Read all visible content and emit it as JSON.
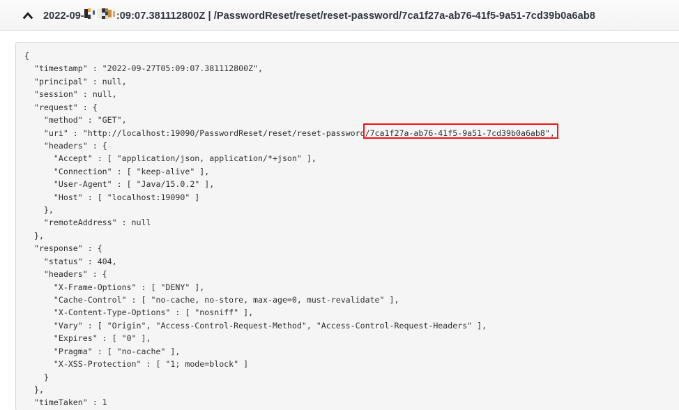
{
  "header": {
    "icon": "chevron-up-icon",
    "timestamp_prefix": "2022-09-",
    "timestamp_suffix": ":09:07.381112800Z",
    "separator": " | ",
    "path": "/PasswordReset/reset/reset-password/7ca1f27a-ab76-41f5-9a51-7cd39b0a6ab8",
    "full_title": "2022-09-27T05:09:07.381112800Z | /PasswordReset/reset/reset-password/7ca1f27a-ab76-41f5-9a51-7cd39b0a6ab8"
  },
  "annotation": {
    "highlight_color": "#f51212",
    "highlighted_text": "/7ca1f27a-ab76-41f5-9a51-7cd39b0a6ab8\""
  },
  "trace": {
    "timestamp": "2022-09-27T05:09:07.381112800Z",
    "principal": "null",
    "session": "null",
    "request": {
      "method": "GET",
      "uri": "http://localhost:19090/PasswordReset/reset/reset-password/7ca1f27a-ab76-41f5-9a51-7cd39b0a6ab8",
      "headers": {
        "Accept": "application/json, application/*+json",
        "Connection": "keep-alive",
        "User-Agent": "Java/15.0.2",
        "Host": "localhost:19090"
      },
      "remoteAddress": "null"
    },
    "response": {
      "status": "404",
      "headers": {
        "X-Frame-Options": "DENY",
        "Cache-Control": "no-cache, no-store, max-age=0, must-revalidate",
        "X-Content-Type-Options": "nosniff",
        "Vary": "\"Origin\", \"Access-Control-Request-Method\", \"Access-Control-Request-Headers\"",
        "Expires": "0",
        "Pragma": "no-cache",
        "X-XSS-Protection": "1; mode=block"
      }
    },
    "timeTaken": "1"
  },
  "code_body": "{\n  \"timestamp\" : \"2022-09-27T05:09:07.381112800Z\",\n  \"principal\" : null,\n  \"session\" : null,\n  \"request\" : {\n    \"method\" : \"GET\",\n    \"uri\" : \"http://localhost:19090/PasswordReset/reset/reset-password/7ca1f27a-ab76-41f5-9a51-7cd39b0a6ab8\",\n    \"headers\" : {\n      \"Accept\" : [ \"application/json, application/*+json\" ],\n      \"Connection\" : [ \"keep-alive\" ],\n      \"User-Agent\" : [ \"Java/15.0.2\" ],\n      \"Host\" : [ \"localhost:19090\" ]\n    },\n    \"remoteAddress\" : null\n  },\n  \"response\" : {\n    \"status\" : 404,\n    \"headers\" : {\n      \"X-Frame-Options\" : [ \"DENY\" ],\n      \"Cache-Control\" : [ \"no-cache, no-store, max-age=0, must-revalidate\" ],\n      \"X-Content-Type-Options\" : [ \"nosniff\" ],\n      \"Vary\" : [ \"Origin\", \"Access-Control-Request-Method\", \"Access-Control-Request-Headers\" ],\n      \"Expires\" : [ \"0\" ],\n      \"Pragma\" : [ \"no-cache\" ],\n      \"X-XSS-Protection\" : [ \"1; mode=block\" ]\n    }\n  },\n  \"timeTaken\" : 1"
}
